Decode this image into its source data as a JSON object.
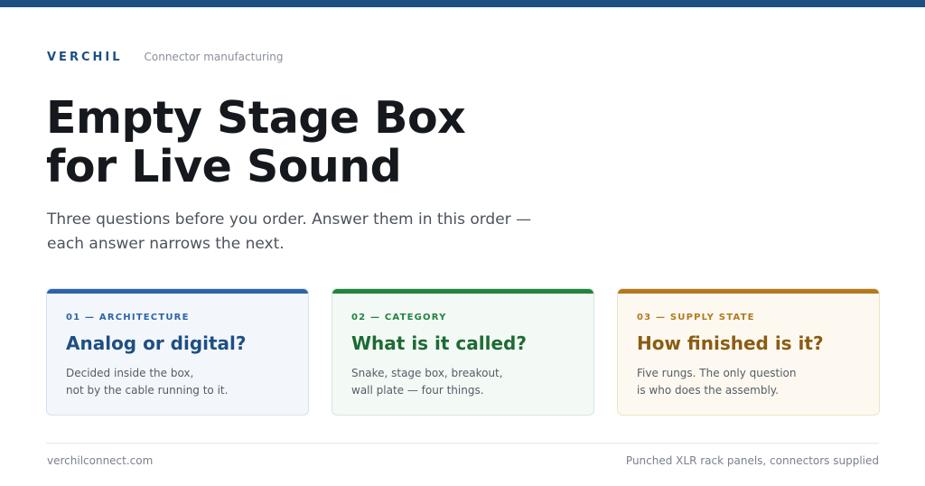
{
  "header": {
    "brand": "VERCHIL",
    "tagline": "Connector manufacturing",
    "accent_color": "#1e4f82"
  },
  "hero": {
    "title_line1": "Empty Stage Box",
    "title_line2": "for Live Sound",
    "subtitle_line1": "Three questions before you order. Answer them in this order —",
    "subtitle_line2": "each answer narrows the next."
  },
  "cards": [
    {
      "kicker": "01 — ARCHITECTURE",
      "heading": "Analog or digital?",
      "body_line1": "Decided inside the box,",
      "body_line2": "not by the cable running to it.",
      "color": "#2d64a7"
    },
    {
      "kicker": "02 — CATEGORY",
      "heading": "What is it called?",
      "body_line1": "Snake, stage box, breakout,",
      "body_line2": "wall plate — four things.",
      "color": "#23833f"
    },
    {
      "kicker": "03 — SUPPLY STATE",
      "heading": "How finished is it?",
      "body_line1": "Five rungs. The only question",
      "body_line2": "is who does the assembly.",
      "color": "#b3791f"
    }
  ],
  "footer": {
    "website": "verchilconnect.com",
    "note": "Punched XLR rack panels, connectors supplied"
  }
}
